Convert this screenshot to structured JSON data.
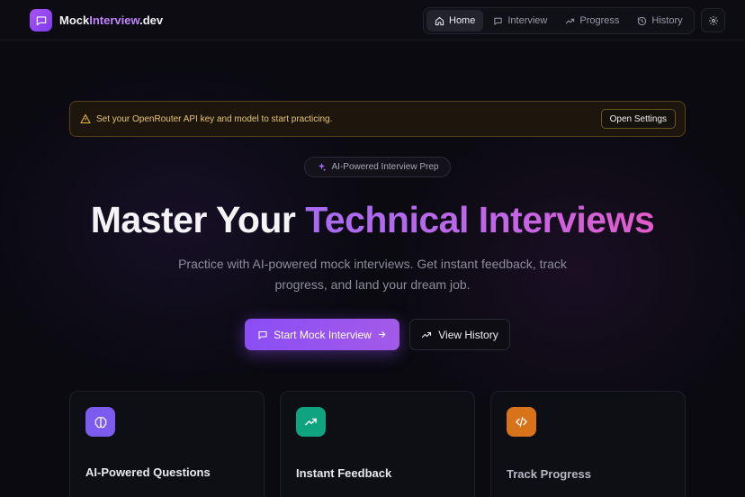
{
  "header": {
    "logo_text_plain": "Mock",
    "logo_text_accent": "Interview",
    "logo_text_suffix": ".dev",
    "nav": [
      {
        "label": "Home",
        "icon": "home-icon",
        "active": true
      },
      {
        "label": "Interview",
        "icon": "chat-icon",
        "active": false
      },
      {
        "label": "Progress",
        "icon": "trending-up-icon",
        "active": false
      },
      {
        "label": "History",
        "icon": "history-icon",
        "active": false
      }
    ],
    "settings_icon": "gear-icon"
  },
  "alert": {
    "text": "Set your OpenRouter API key and model to start practicing.",
    "button_label": "Open Settings",
    "icon": "warning-triangle-icon"
  },
  "hero": {
    "pill_label": "AI-Powered Interview Prep",
    "title_plain": "Master Your ",
    "title_gradient": "Technical Interviews",
    "subtitle": "Practice with AI-powered mock interviews. Get instant feedback, track progress, and land your dream job.",
    "primary_button": "Start Mock Interview",
    "secondary_button": "View History"
  },
  "features": [
    {
      "title": "AI-Powered Questions",
      "icon": "brain-icon",
      "color": "#7c5cf0"
    },
    {
      "title": "Instant Feedback",
      "icon": "trending-up-icon",
      "color": "#10a37f"
    },
    {
      "title": "Track Progress",
      "icon": "code-icon",
      "color": "#d9731a"
    }
  ],
  "colors": {
    "accent": "#8b4ef5",
    "background": "#0a0a10",
    "warning": "#e8c473"
  }
}
